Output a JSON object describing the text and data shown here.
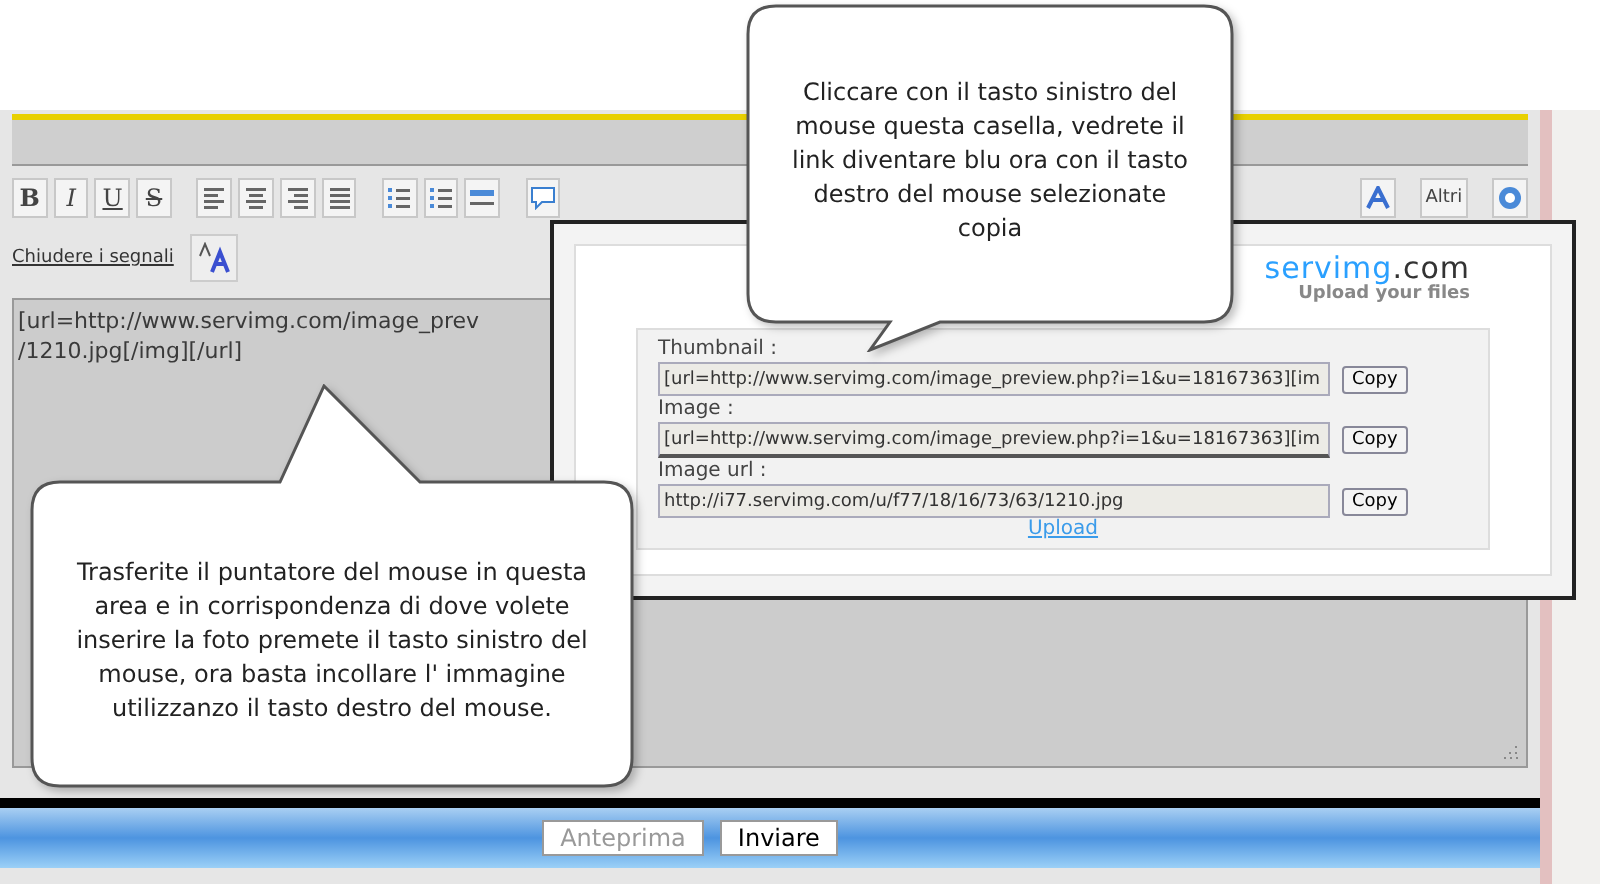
{
  "editor": {
    "toolbar": [
      {
        "kind": "bold",
        "label": "B"
      },
      {
        "kind": "italic",
        "label": "I"
      },
      {
        "kind": "underline",
        "label": "U"
      },
      {
        "kind": "strike",
        "label": "S"
      },
      {
        "kind": "align-left"
      },
      {
        "kind": "align-center"
      },
      {
        "kind": "align-right"
      },
      {
        "kind": "justify"
      },
      {
        "kind": "bullet-list"
      },
      {
        "kind": "number-list"
      },
      {
        "kind": "rule"
      },
      {
        "kind": "speech"
      },
      {
        "kind": "font-a"
      },
      {
        "kind": "word",
        "label": "Altri"
      },
      {
        "kind": "help"
      }
    ],
    "close_tags_link": "Chiudere i segnali",
    "text": "[url=http://www.servimg.com/image_prev\n/1210.jpg[/img][/url]"
  },
  "upload_panel": {
    "logo": {
      "brand": "servimg",
      ".com": ".com",
      "tagline": "Upload your files"
    },
    "fields": [
      {
        "label": "Thumbnail :",
        "value": "[url=http://www.servimg.com/image_preview.php?i=1&u=18167363][im",
        "button": "Copy",
        "selected": false
      },
      {
        "label": "Image :",
        "value": "[url=http://www.servimg.com/image_preview.php?i=1&u=18167363][im",
        "button": "Copy",
        "selected": true
      },
      {
        "label": "Image url :",
        "value": "http://i77.servimg.com/u/f77/18/16/73/63/1210.jpg",
        "button": "Copy",
        "selected": false
      }
    ],
    "upload_link": "Upload"
  },
  "callouts": [
    {
      "text": "Cliccare con il tasto sinistro del mouse questa casella, vedrete il link diventare blu ora con il tasto destro del mouse selezionate copia"
    },
    {
      "text": "Trasferite il puntatore del mouse in questa area e in corrispondenza di dove volete inserire la foto premete il tasto sinistro del mouse, ora basta incollare l' immagine utilizzanzo il tasto destro del mouse."
    }
  ],
  "buttons": [
    {
      "label": "Anteprima",
      "disabled": true
    },
    {
      "label": "Inviare",
      "disabled": false
    }
  ]
}
